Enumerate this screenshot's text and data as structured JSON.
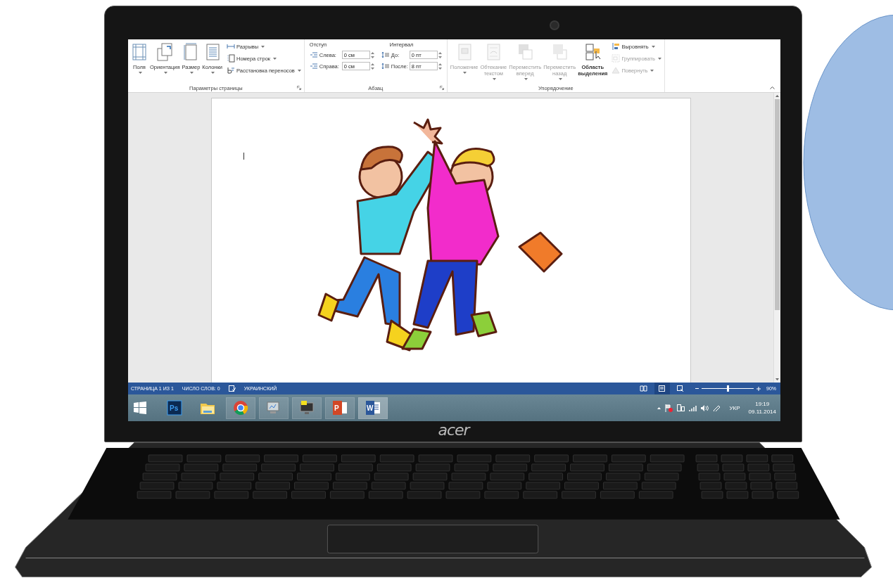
{
  "ribbon": {
    "groups": [
      {
        "kind": "page",
        "title": "Параметры страницы",
        "large_buttons": [
          {
            "label": "Поля",
            "dropdown": true,
            "disabled": false
          },
          {
            "label": "Ориентация",
            "dropdown": true,
            "disabled": false
          },
          {
            "label": "Размер",
            "dropdown": true,
            "disabled": false
          },
          {
            "label": "Колонки",
            "dropdown": true,
            "disabled": false
          }
        ],
        "small_buttons": [
          {
            "label": "Разрывы",
            "dropdown": true,
            "disabled": false
          },
          {
            "label": "Номера строк",
            "dropdown": true,
            "disabled": false
          },
          {
            "label": "Расстановка переносов",
            "dropdown": true,
            "disabled": false
          }
        ]
      },
      {
        "kind": "paragraph",
        "title": "Абзац",
        "indent": {
          "header": "Отступ",
          "fields": [
            {
              "label": "Слева:",
              "value": "0 см"
            },
            {
              "label": "Справа:",
              "value": "0 см"
            }
          ]
        },
        "spacing": {
          "header": "Интервал",
          "fields": [
            {
              "label": "До:",
              "value": "0 пт"
            },
            {
              "label": "После:",
              "value": "8 пт"
            }
          ]
        }
      },
      {
        "kind": "arrange",
        "title": "Упорядочение",
        "large_buttons": [
          {
            "label": "Положение",
            "dropdown": true,
            "disabled": true
          },
          {
            "label": "Обтекание текстом",
            "dropdown": true,
            "disabled": true
          },
          {
            "label": "Переместить вперед",
            "dropdown": true,
            "disabled": true
          },
          {
            "label": "Переместить назад",
            "dropdown": true,
            "disabled": true
          },
          {
            "label": "Область выделения",
            "dropdown": false,
            "disabled": false
          }
        ],
        "small_buttons": [
          {
            "label": "Выровнять",
            "dropdown": true,
            "disabled": false
          },
          {
            "label": "Группировать",
            "dropdown": true,
            "disabled": true
          },
          {
            "label": "Повернуть",
            "dropdown": true,
            "disabled": true
          }
        ]
      }
    ]
  },
  "status_bar": {
    "items": [
      {
        "kind": "text",
        "text": "СТРАНИЦА 1 ИЗ 1"
      },
      {
        "kind": "text",
        "text": "ЧИСЛО СЛОВ: 0"
      },
      {
        "kind": "proofing"
      },
      {
        "kind": "text",
        "text": "УКРАИНСКИЙ"
      }
    ],
    "views": [
      {
        "kind": "read",
        "selected": false
      },
      {
        "kind": "print",
        "selected": true
      },
      {
        "kind": "web",
        "selected": false
      }
    ],
    "zoom": {
      "level": 0.5,
      "reading": "90%"
    }
  },
  "taskbar": {
    "apps": [
      {
        "kind": "photoshop",
        "badge": "Ps",
        "running": false,
        "selected": false
      },
      {
        "kind": "explorer",
        "running": false,
        "selected": false
      },
      {
        "kind": "chrome",
        "running": true,
        "selected": false
      },
      {
        "kind": "monitor",
        "running": true,
        "selected": false
      },
      {
        "kind": "display",
        "running": true,
        "selected": false
      },
      {
        "kind": "powerpoint",
        "badge": "P",
        "running": true,
        "selected": false
      },
      {
        "kind": "word",
        "badge": "W",
        "running": true,
        "selected": true
      }
    ],
    "tray": {
      "language": "УКР",
      "time": "19:19",
      "date": "09.11.2014"
    }
  },
  "laptop": {
    "logo": "acer"
  }
}
